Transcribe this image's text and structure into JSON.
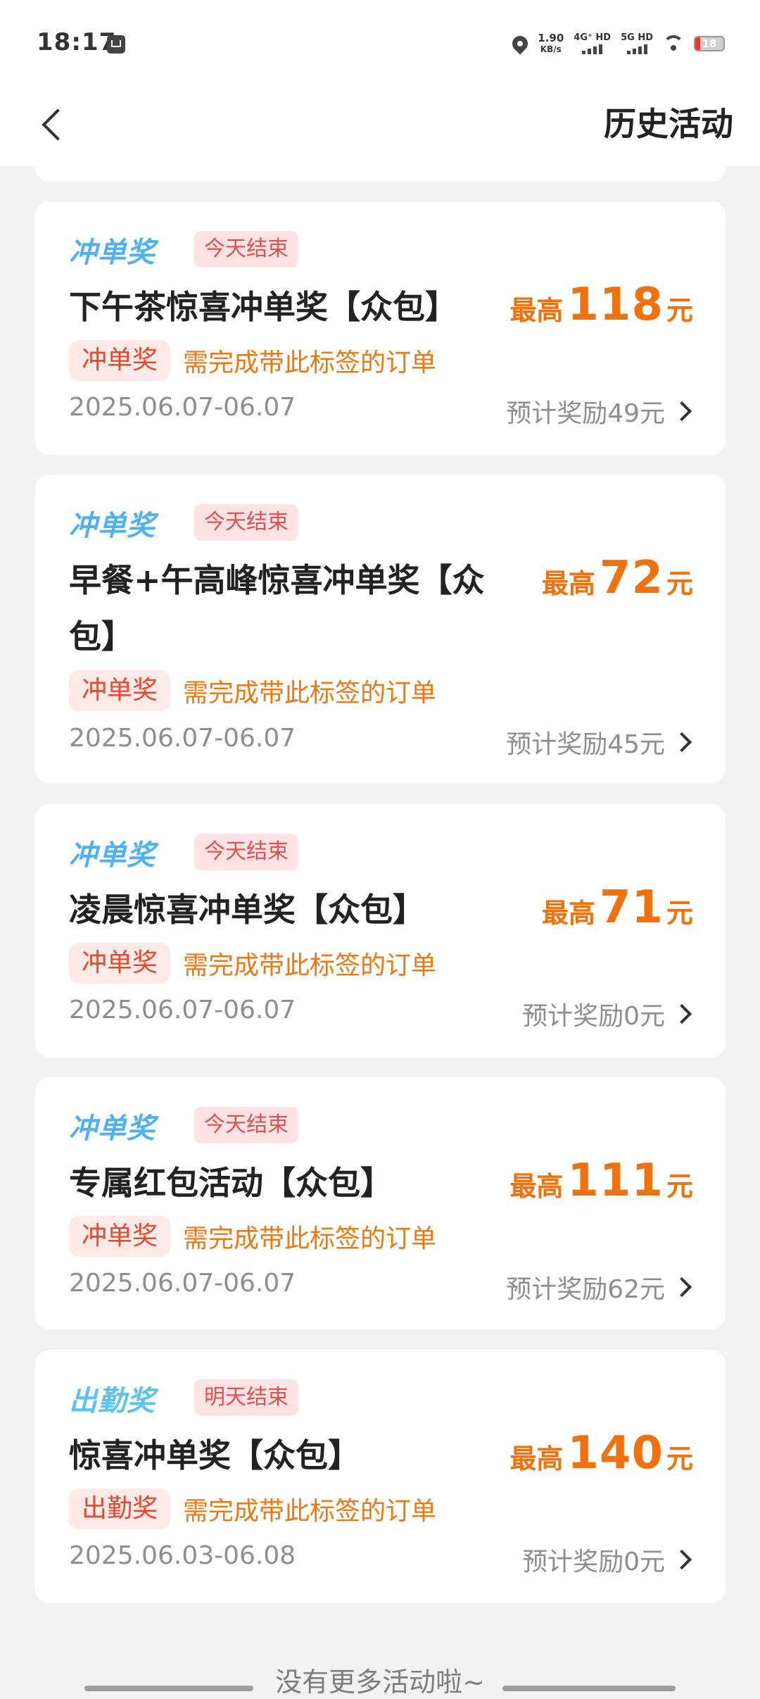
{
  "status_bar": {
    "time": "18:17",
    "speed_value": "1.90",
    "speed_unit": "KB/s",
    "net1": "4G⁺ HD",
    "net2": "5G HD",
    "battery": "18"
  },
  "header": {
    "title": "历史活动"
  },
  "cards": [
    {
      "type_label": "冲单奖",
      "badge": "今天结束",
      "title": "下午茶惊喜冲单奖【众包】",
      "max_prefix": "最高",
      "max_value": "118",
      "max_unit": "元",
      "tag": "冲单奖",
      "tag_desc": "需完成带此标签的订单",
      "date_range": "2025.06.07-06.07",
      "estimate": "预计奖励49元"
    },
    {
      "type_label": "冲单奖",
      "badge": "今天结束",
      "title": "早餐+午高峰惊喜冲单奖【众包】",
      "max_prefix": "最高",
      "max_value": "72",
      "max_unit": "元",
      "tag": "冲单奖",
      "tag_desc": "需完成带此标签的订单",
      "date_range": "2025.06.07-06.07",
      "estimate": "预计奖励45元"
    },
    {
      "type_label": "冲单奖",
      "badge": "今天结束",
      "title": "凌晨惊喜冲单奖【众包】",
      "max_prefix": "最高",
      "max_value": "71",
      "max_unit": "元",
      "tag": "冲单奖",
      "tag_desc": "需完成带此标签的订单",
      "date_range": "2025.06.07-06.07",
      "estimate": "预计奖励0元"
    },
    {
      "type_label": "冲单奖",
      "badge": "今天结束",
      "title": "专属红包活动【众包】",
      "max_prefix": "最高",
      "max_value": "111",
      "max_unit": "元",
      "tag": "冲单奖",
      "tag_desc": "需完成带此标签的订单",
      "date_range": "2025.06.07-06.07",
      "estimate": "预计奖励62元"
    },
    {
      "type_label": "出勤奖",
      "badge": "明天结束",
      "title": "惊喜冲单奖【众包】",
      "max_prefix": "最高",
      "max_value": "140",
      "max_unit": "元",
      "tag": "出勤奖",
      "tag_desc": "需完成带此标签的订单",
      "date_range": "2025.06.03-06.08",
      "estimate": "预计奖励0元"
    }
  ],
  "footer": {
    "no_more_text": "没有更多活动啦~"
  },
  "colors": {
    "accent_orange": "#f0720e",
    "type_blue": "#4eb0f5",
    "badge_red": "#e2504f",
    "tag_red": "#e6482f"
  }
}
